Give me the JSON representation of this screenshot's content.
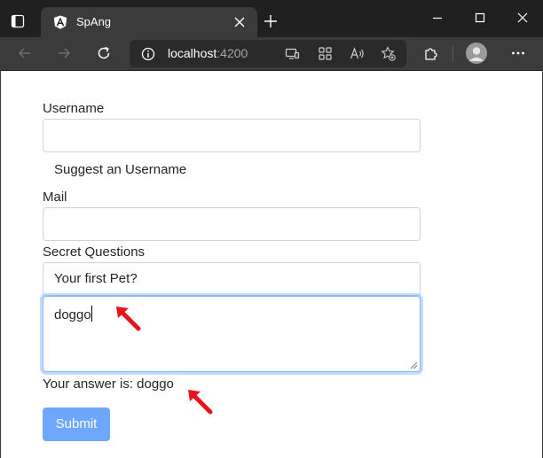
{
  "browser": {
    "tab_title": "SpAng",
    "url_host": "localhost",
    "url_port": ":4200",
    "icons": {
      "tab_actions": "tab-actions-icon",
      "favicon": "angular-logo-icon",
      "tab_close": "close-icon",
      "new_tab": "plus-icon",
      "minimize": "minimize-icon",
      "maximize": "maximize-icon",
      "close_window": "close-icon",
      "back": "arrow-left-icon",
      "forward": "arrow-right-icon",
      "refresh": "refresh-icon",
      "site_info": "info-icon",
      "cast": "cast-icon",
      "apps": "apps-icon",
      "read_aloud": "read-aloud-icon",
      "favorites": "favorite-add-icon",
      "extensions": "puzzle-icon",
      "profile": "avatar-icon",
      "more": "more-icon"
    }
  },
  "form": {
    "username_label": "Username",
    "username_value": "",
    "suggest_label": "Suggest an Username",
    "mail_label": "Mail",
    "mail_value": "",
    "secret_label": "Secret Questions",
    "secret_question_selected": "Your first Pet?",
    "answer_value": "doggo",
    "answer_preview": "Your answer is: doggo",
    "submit_label": "Submit"
  },
  "colors": {
    "accent": "#0d6efd",
    "submit_disabled": "#6ea8fe",
    "annotation_arrow": "#e8141c"
  }
}
